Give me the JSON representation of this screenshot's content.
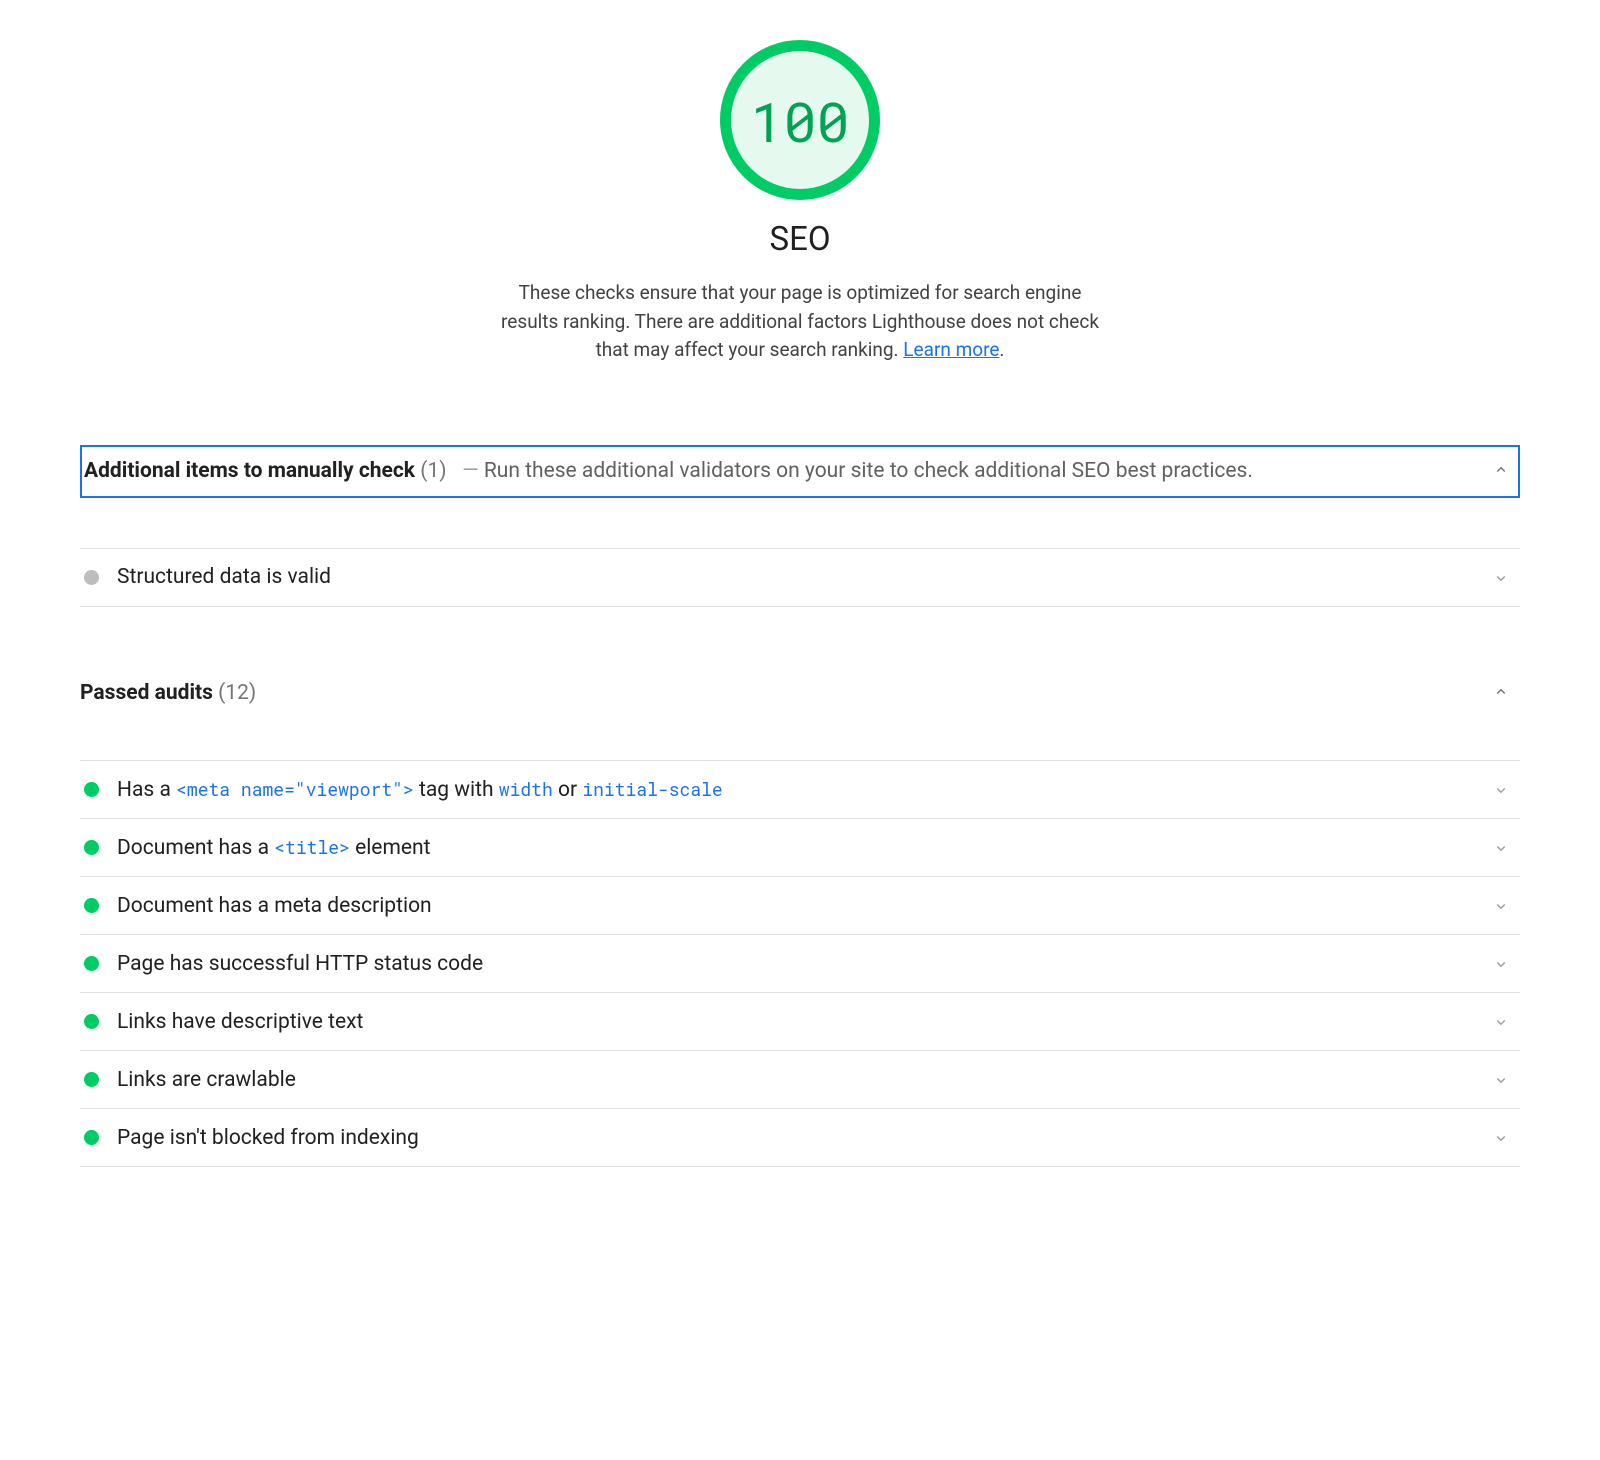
{
  "header": {
    "score": "100",
    "title": "SEO",
    "description_pre": "These checks ensure that your page is optimized for search engine results ranking. There are additional factors Lighthouse does not check that may affect your search ranking. ",
    "learn_more": "Learn more"
  },
  "groups": {
    "manual": {
      "title": "Additional items to manually check",
      "count": "(1)",
      "dash": "—",
      "desc": "Run these additional validators on your site to check additional SEO best practices.",
      "items": [
        {
          "title": "Structured data is valid"
        }
      ]
    },
    "passed": {
      "title": "Passed audits",
      "count": "(12)",
      "items": [
        {
          "parts": [
            "Has a ",
            " tag with ",
            " or "
          ],
          "codes": [
            "<meta name=\"viewport\">",
            "width",
            "initial-scale"
          ]
        },
        {
          "parts": [
            "Document has a ",
            " element"
          ],
          "codes": [
            "<title>"
          ]
        },
        {
          "title": "Document has a meta description"
        },
        {
          "title": "Page has successful HTTP status code"
        },
        {
          "title": "Links have descriptive text"
        },
        {
          "title": "Links are crawlable"
        },
        {
          "title": "Page isn't blocked from indexing"
        }
      ]
    }
  }
}
